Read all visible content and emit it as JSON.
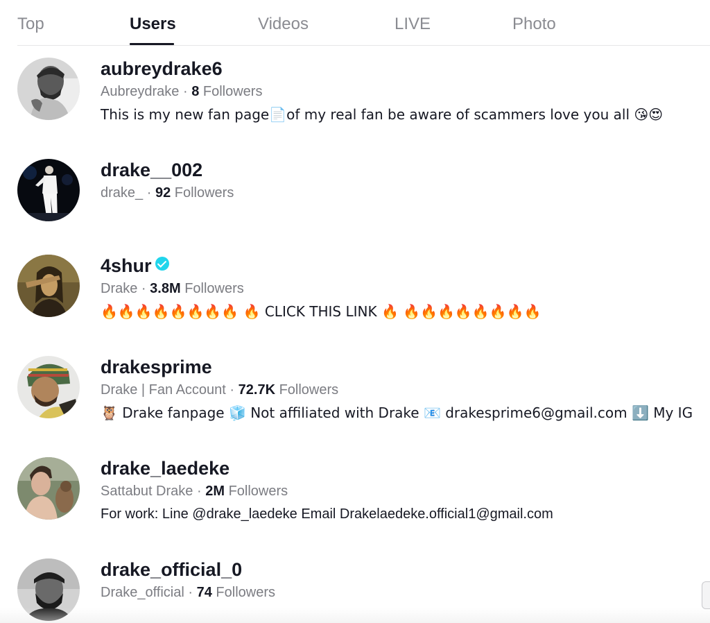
{
  "tabs": [
    {
      "label": "Top",
      "active": false
    },
    {
      "label": "Users",
      "active": true
    },
    {
      "label": "Videos",
      "active": false
    },
    {
      "label": "LIVE",
      "active": false
    },
    {
      "label": "Photo",
      "active": false
    }
  ],
  "users": [
    {
      "username": "aubreydrake6",
      "nickname": "Aubreydrake",
      "separator": "·",
      "followers": "8",
      "followers_label": "Followers",
      "verified": false,
      "bio": "This is my new fan page📄of my real fan be aware of scammers love you all 😘😍"
    },
    {
      "username": "drake__002",
      "nickname": "drake_",
      "separator": "·",
      "followers": "92",
      "followers_label": "Followers",
      "verified": false,
      "bio": ""
    },
    {
      "username": "4shur",
      "nickname": "Drake",
      "separator": "·",
      "followers": "3.8M",
      "followers_label": "Followers",
      "verified": true,
      "bio": "🔥🔥🔥🔥🔥🔥🔥🔥 🔥 CLICK THIS LINK 🔥 🔥🔥🔥🔥🔥🔥🔥🔥"
    },
    {
      "username": "drakesprime",
      "nickname": "Drake | Fan Account",
      "separator": "·",
      "followers": "72.7K",
      "followers_label": "Followers",
      "verified": false,
      "bio": "🦉 Drake fanpage 🧊 Not affiliated with Drake 📧 drakesprime6@gmail.com ⬇️ My IG"
    },
    {
      "username": "drake_laedeke",
      "nickname": "Sattabut Drake",
      "separator": "·",
      "followers": "2M",
      "followers_label": "Followers",
      "verified": false,
      "bio": "For work: Line @drake_laedeke Email Drakelaedeke.official1@gmail.com"
    },
    {
      "username": "drake_official_0",
      "nickname": "Drake_official",
      "separator": "·",
      "followers": "74",
      "followers_label": "Followers",
      "verified": false,
      "bio": ""
    }
  ],
  "colors": {
    "text_primary": "#161823",
    "text_secondary": "#7b7c82",
    "tab_inactive": "#8a8b91",
    "verified_badge": "#20d5ec",
    "divider": "#e6e6e7"
  },
  "icons": {
    "verified": "verified-check-icon"
  }
}
